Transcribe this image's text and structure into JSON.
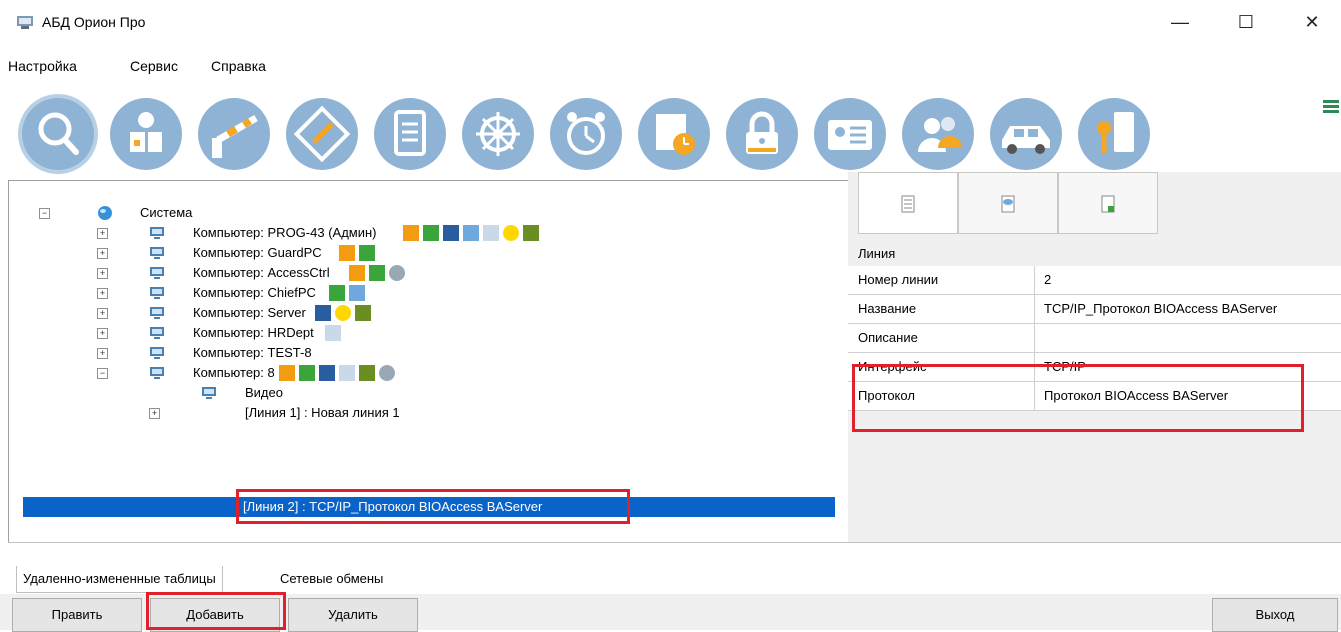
{
  "window": {
    "title": "АБД Орион Про",
    "minimize": "—",
    "maximize": "☐",
    "close": "✕"
  },
  "menu": [
    "Настройка",
    "Сервис",
    "Справка"
  ],
  "toolbar": {
    "buttons": [
      "search-icon",
      "devices-icon",
      "barrier-icon",
      "floorplan-icon",
      "document-icon",
      "ship-wheel-icon",
      "alarm-clock-icon",
      "schedule-icon",
      "lock-icon",
      "id-card-icon",
      "people-icon",
      "car-icon",
      "key-icon"
    ],
    "accent": "#8fb3d4"
  },
  "tree": {
    "root": "Система",
    "computers": [
      "Компьютер: PROG-43 (Админ)",
      "Компьютер: GuardPC",
      "Компьютер: AccessCtrl",
      "Компьютер: ChiefPC",
      "Компьютер: Server",
      "Компьютер: HRDept",
      "Компьютер: TEST-8",
      "Компьютер: 8"
    ],
    "children": [
      "Видео",
      "[Линия 1] : Новая линия 1",
      "[Линия 2] : TCP/IP_Протокол BIOAccess BAServer"
    ],
    "selected_color": "#0a63c9"
  },
  "properties": {
    "section": "Линия",
    "rows": [
      {
        "name": "Номер линии",
        "value": "2"
      },
      {
        "name": "Название",
        "value": "TCP/IP_Протокол BIOAccess BAServer"
      },
      {
        "name": "Описание",
        "value": ""
      },
      {
        "name": "Интерфейс",
        "value": "TCP/IP"
      },
      {
        "name": "Протокол",
        "value": "Протокол BIOAccess BAServer"
      }
    ]
  },
  "bottom_tabs": [
    "Удаленно-измененные таблицы",
    "Сетевые обмены"
  ],
  "buttons": {
    "edit": "Править",
    "add": "Добавить",
    "delete": "Удалить",
    "exit": "Выход"
  },
  "highlight_color": "#e0202a"
}
